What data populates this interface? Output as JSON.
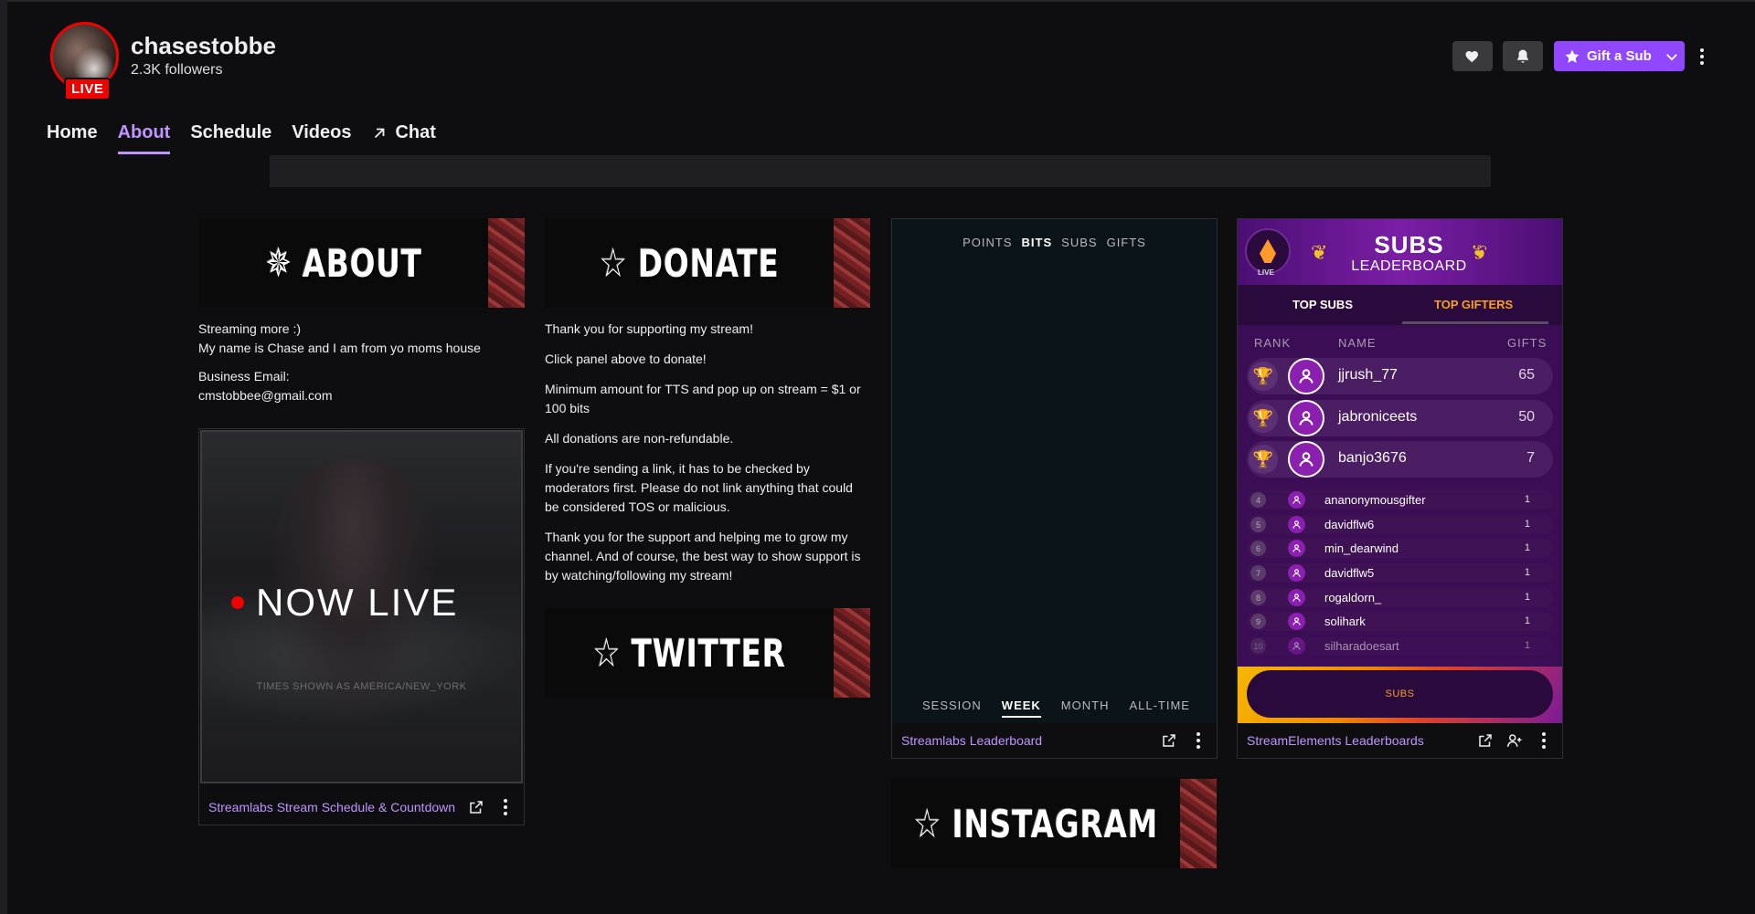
{
  "channel": {
    "name": "chasestobbe",
    "followers": "2.3K followers",
    "live_badge": "LIVE"
  },
  "header_actions": {
    "gift_label": "Gift a Sub"
  },
  "nav": {
    "home": "Home",
    "about": "About",
    "schedule": "Schedule",
    "videos": "Videos",
    "chat": "Chat"
  },
  "panels": {
    "about": {
      "banner": "ABOUT",
      "lines": [
        "Streaming more :)",
        "My name is Chase and I am from yo moms house"
      ],
      "business_label": "Business Email:",
      "business_email": "cmstobbee@gmail.com"
    },
    "donate": {
      "banner": "DONATE",
      "paragraphs": [
        "Thank you for supporting my stream!",
        "Click panel above to donate!",
        "Minimum amount for TTS and pop up on stream = $1 or 100 bits",
        "All donations are non-refundable.",
        "If you're sending a link, it has to be checked by moderators first. Please do not link anything that could be considered TOS or malicious.",
        "Thank you for the support and helping me to grow my channel. And of course, the best way to show support is by watching/following my stream!"
      ]
    },
    "twitter": {
      "banner": "TWITTER"
    },
    "instagram": {
      "banner": "INSTAGRAM"
    }
  },
  "schedule_ext": {
    "now_live": "NOW LIVE",
    "times_note": "TIMES SHOWN AS AMERICA/NEW_YORK",
    "title": "Streamlabs Stream Schedule & Countdown"
  },
  "streamlabs_ext": {
    "top_tabs": [
      "POINTS",
      "BITS",
      "SUBS",
      "GIFTS"
    ],
    "active_top_tab": "BITS",
    "bottom_tabs": [
      "SESSION",
      "WEEK",
      "MONTH",
      "ALL-TIME"
    ],
    "active_bottom_tab": "WEEK",
    "title": "Streamlabs Leaderboard"
  },
  "streamelements_ext": {
    "title": "StreamElements Leaderboards",
    "live_label": "LIVE",
    "header_title": "SUBS",
    "header_subtitle": "LEADERBOARD",
    "tabs": [
      "TOP SUBS",
      "TOP GIFTERS"
    ],
    "active_tab": "TOP GIFTERS",
    "columns": [
      "RANK",
      "NAME",
      "GIFTS"
    ],
    "top3": [
      {
        "name": "jjrush_77",
        "gifts": "65"
      },
      {
        "name": "jabroniceets",
        "gifts": "50"
      },
      {
        "name": "banjo3676",
        "gifts": "7"
      }
    ],
    "rest": [
      {
        "rank": "4",
        "name": "ananonymousgifter",
        "gifts": "1"
      },
      {
        "rank": "5",
        "name": "davidflw6",
        "gifts": "1"
      },
      {
        "rank": "6",
        "name": "min_dearwind",
        "gifts": "1"
      },
      {
        "rank": "7",
        "name": "davidflw5",
        "gifts": "1"
      },
      {
        "rank": "8",
        "name": "rogaldorn_",
        "gifts": "1"
      },
      {
        "rank": "9",
        "name": "solihark",
        "gifts": "1"
      },
      {
        "rank": "10",
        "name": "silharadoesart",
        "gifts": "1"
      }
    ],
    "bottom_button": "SUBS"
  },
  "colors": {
    "accent": "#9147ff",
    "accent_text": "#bf94ff",
    "live_red": "#eb0400",
    "background": "#0e0e10"
  },
  "icons": [
    "heart-icon",
    "bell-icon",
    "star-icon",
    "chevron-down-icon",
    "kebab-icon",
    "arrow-up-right-icon",
    "popout-icon",
    "user-add-icon",
    "trophy-icon",
    "user-icon"
  ]
}
